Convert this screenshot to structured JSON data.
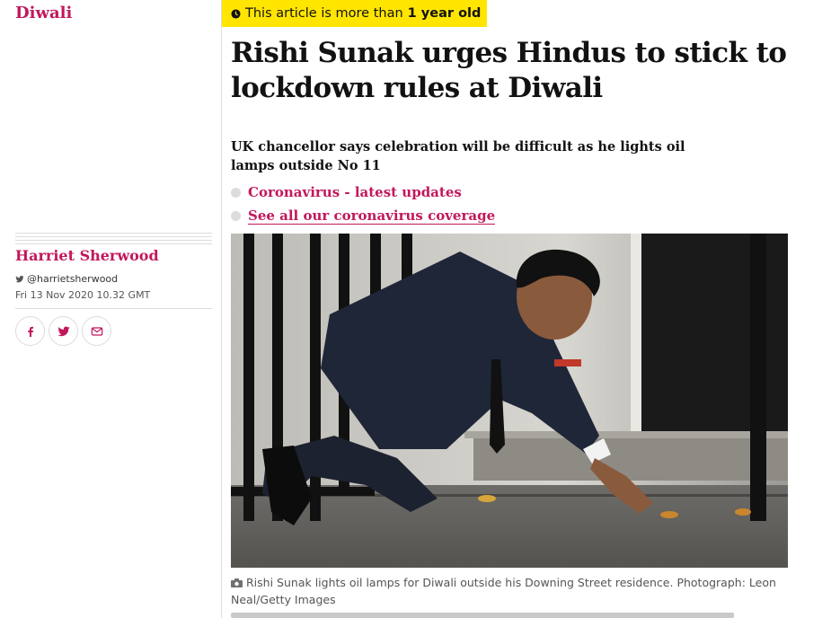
{
  "section": {
    "label": "Diwali"
  },
  "byline": {
    "author": "Harriet Sherwood",
    "twitter_handle": "@harrietsherwood",
    "date": "Fri 13 Nov 2020 10.32 GMT",
    "share_icons": [
      "facebook-icon",
      "twitter-icon",
      "email-icon"
    ]
  },
  "age_warning": {
    "prefix": "This article is more than",
    "age": "1 year old",
    "icon": "clock-icon"
  },
  "article": {
    "headline": "Rishi Sunak urges Hindus to stick to lockdown rules at Diwali",
    "standfirst": "UK chancellor says celebration will be difficult as he lights oil lamps outside No 11",
    "related_links": [
      {
        "label": "Coronavirus - latest updates"
      },
      {
        "label": "See all our coronavirus coverage"
      }
    ],
    "caption": "Rishi Sunak lights oil lamps for Diwali outside his Downing Street residence. Photograph: Leon Neal/Getty Images"
  },
  "colors": {
    "accent": "#c2185b",
    "banner": "#ffe500",
    "text": "#121212",
    "rule": "#dcdcdc"
  }
}
